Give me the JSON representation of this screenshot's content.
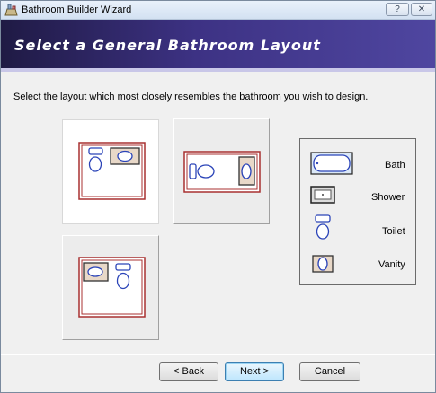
{
  "window": {
    "title": "Bathroom Builder Wizard",
    "help_label": "?",
    "close_label": "✕"
  },
  "banner": {
    "heading": "Select a General Bathroom Layout"
  },
  "instruction": "Select the layout which most closely resembles the bathroom you wish to design.",
  "layouts": [
    {
      "name": "toilet-and-bath-top",
      "selected": true
    },
    {
      "name": "bath-and-shower-horizontal",
      "selected": false
    },
    {
      "name": "vanity-and-toilet-top",
      "selected": false
    }
  ],
  "legend": {
    "items": [
      {
        "icon": "bath-icon",
        "label": "Bath"
      },
      {
        "icon": "shower-icon",
        "label": "Shower"
      },
      {
        "icon": "toilet-icon",
        "label": "Toilet"
      },
      {
        "icon": "vanity-icon",
        "label": "Vanity"
      }
    ]
  },
  "buttons": {
    "back": "< Back",
    "next": "Next >",
    "cancel": "Cancel"
  },
  "colors": {
    "wall": "#a83030",
    "fixture_stroke": "#2b44b8",
    "fixture_fill": "#e8d8c8",
    "banner": "#3d3284"
  }
}
